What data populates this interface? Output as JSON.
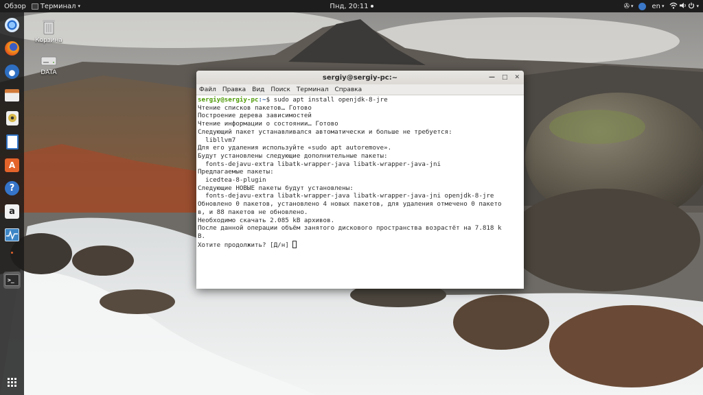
{
  "topbar": {
    "activities": "Обзор",
    "app_name": "Терминал",
    "clock": "Пнд, 20:11",
    "language": "en"
  },
  "desktop": {
    "trash_label": "Корзина",
    "data_label": "DATA"
  },
  "terminal": {
    "title": "sergiy@sergiy-pc:~",
    "menu": [
      "Файл",
      "Правка",
      "Вид",
      "Поиск",
      "Терминал",
      "Справка"
    ],
    "prompt_user": "sergiy@sergiy-pc",
    "prompt_path": ":~",
    "command": "$ sudo apt install openjdk-8-jre",
    "output": [
      "Чтение списков пакетов… Готово",
      "Построение дерева зависимостей",
      "Чтение информации о состоянии… Готово",
      "Следующий пакет устанавливался автоматически и больше не требуется:",
      "  libllvm7",
      "Для его удаления используйте «sudo apt autoremove».",
      "Будут установлены следующие дополнительные пакеты:",
      "  fonts-dejavu-extra libatk-wrapper-java libatk-wrapper-java-jni",
      "Предлагаемые пакеты:",
      "  icedtea-8-plugin",
      "Следующие НОВЫЕ пакеты будут установлены:",
      "  fonts-dejavu-extra libatk-wrapper-java libatk-wrapper-java-jni openjdk-8-jre",
      "Обновлено 0 пакетов, установлено 4 новых пакетов, для удаления отмечено 0 пакето",
      "в, и 88 пакетов не обновлено.",
      "Необходимо скачать 2.085 kB архивов.",
      "После данной операции объём занятого дискового пространства возрастёт на 7.818 k",
      "B."
    ],
    "question": "Хотите продолжить? [Д/н] "
  },
  "dock": [
    {
      "icon": "chromium-icon",
      "color": "#4a8fd6"
    },
    {
      "icon": "firefox-icon",
      "color": "#e8631c"
    },
    {
      "icon": "thunderbird-icon",
      "color": "#2e6fc2"
    },
    {
      "icon": "files-icon",
      "color": "#b0642c"
    },
    {
      "icon": "rhythmbox-icon",
      "color": "#d7b84a"
    },
    {
      "icon": "writer-icon",
      "color": "#2f72c4"
    },
    {
      "icon": "software-center-icon",
      "color": "#e4632a"
    },
    {
      "icon": "help-icon",
      "color": "#3574c9"
    },
    {
      "icon": "amazon-icon",
      "color": "#f2f2f2"
    },
    {
      "icon": "system-monitor-icon",
      "color": "#3d86c6"
    },
    {
      "icon": "terminal-icon",
      "color": "#2c2c2c"
    },
    {
      "icon": "app-grid-icon",
      "color": "#ffffff"
    }
  ]
}
